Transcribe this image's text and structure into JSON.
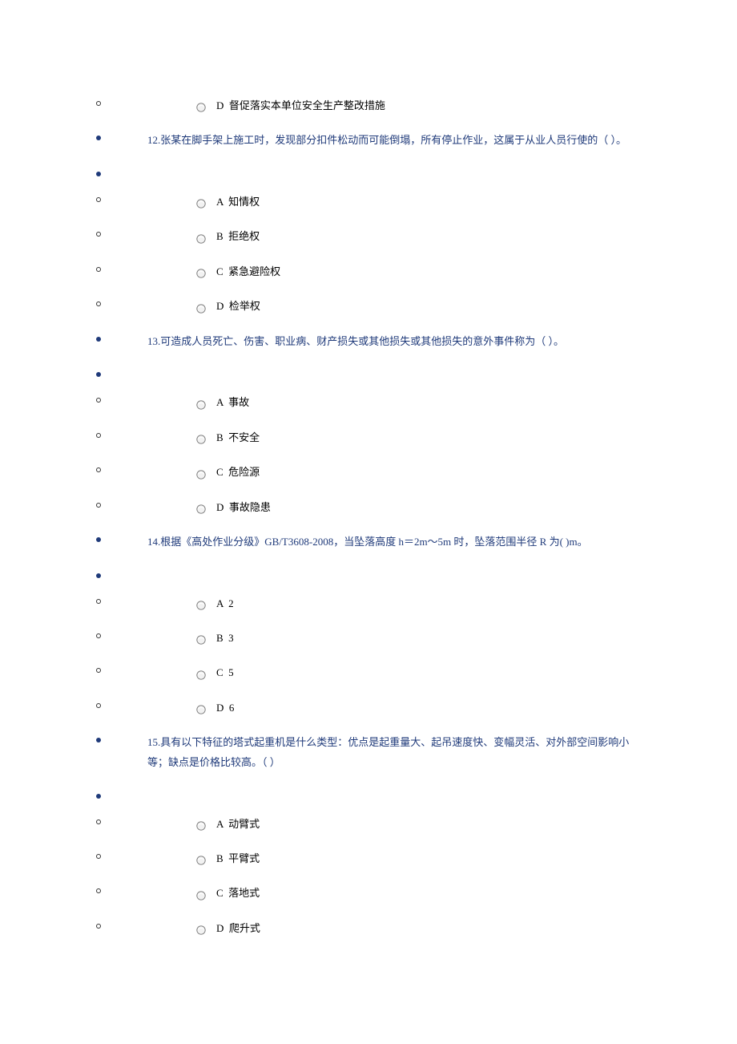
{
  "lead_option": {
    "key": "D",
    "text": "督促落实本单位安全生产整改措施"
  },
  "questions": [
    {
      "number": "12",
      "text": "12.张某在脚手架上施工时，发现部分扣件松动而可能倒塌，所有停止作业，这属于从业人员行使的（ ）。",
      "options": [
        {
          "key": "A",
          "text": "知情权"
        },
        {
          "key": "B",
          "text": "拒绝权"
        },
        {
          "key": "C",
          "text": "紧急避险权"
        },
        {
          "key": "D",
          "text": "检举权"
        }
      ]
    },
    {
      "number": "13",
      "text": "13.可造成人员死亡、伤害、职业病、财产损失或其他损失或其他损失的意外事件称为（ ）。",
      "options": [
        {
          "key": "A",
          "text": "事故"
        },
        {
          "key": "B",
          "text": "不安全"
        },
        {
          "key": "C",
          "text": "危险源"
        },
        {
          "key": "D",
          "text": "事故隐患"
        }
      ]
    },
    {
      "number": "14",
      "text": "14.根据《高处作业分级》GB/T3608-2008，当坠落高度 h＝2m～5m 时，坠落范围半径 R 为( )m。",
      "options": [
        {
          "key": "A",
          "text": "2"
        },
        {
          "key": "B",
          "text": "3"
        },
        {
          "key": "C",
          "text": "5"
        },
        {
          "key": "D",
          "text": "6"
        }
      ]
    },
    {
      "number": "15",
      "text": "15.具有以下特征的塔式起重机是什么类型：优点是起重量大、起吊速度快、变幅灵活、对外部空间影响小等；缺点是价格比较高。（ ）",
      "options": [
        {
          "key": "A",
          "text": "动臂式"
        },
        {
          "key": "B",
          "text": "平臂式"
        },
        {
          "key": "C",
          "text": "落地式"
        },
        {
          "key": "D",
          "text": "爬升式"
        }
      ]
    }
  ]
}
